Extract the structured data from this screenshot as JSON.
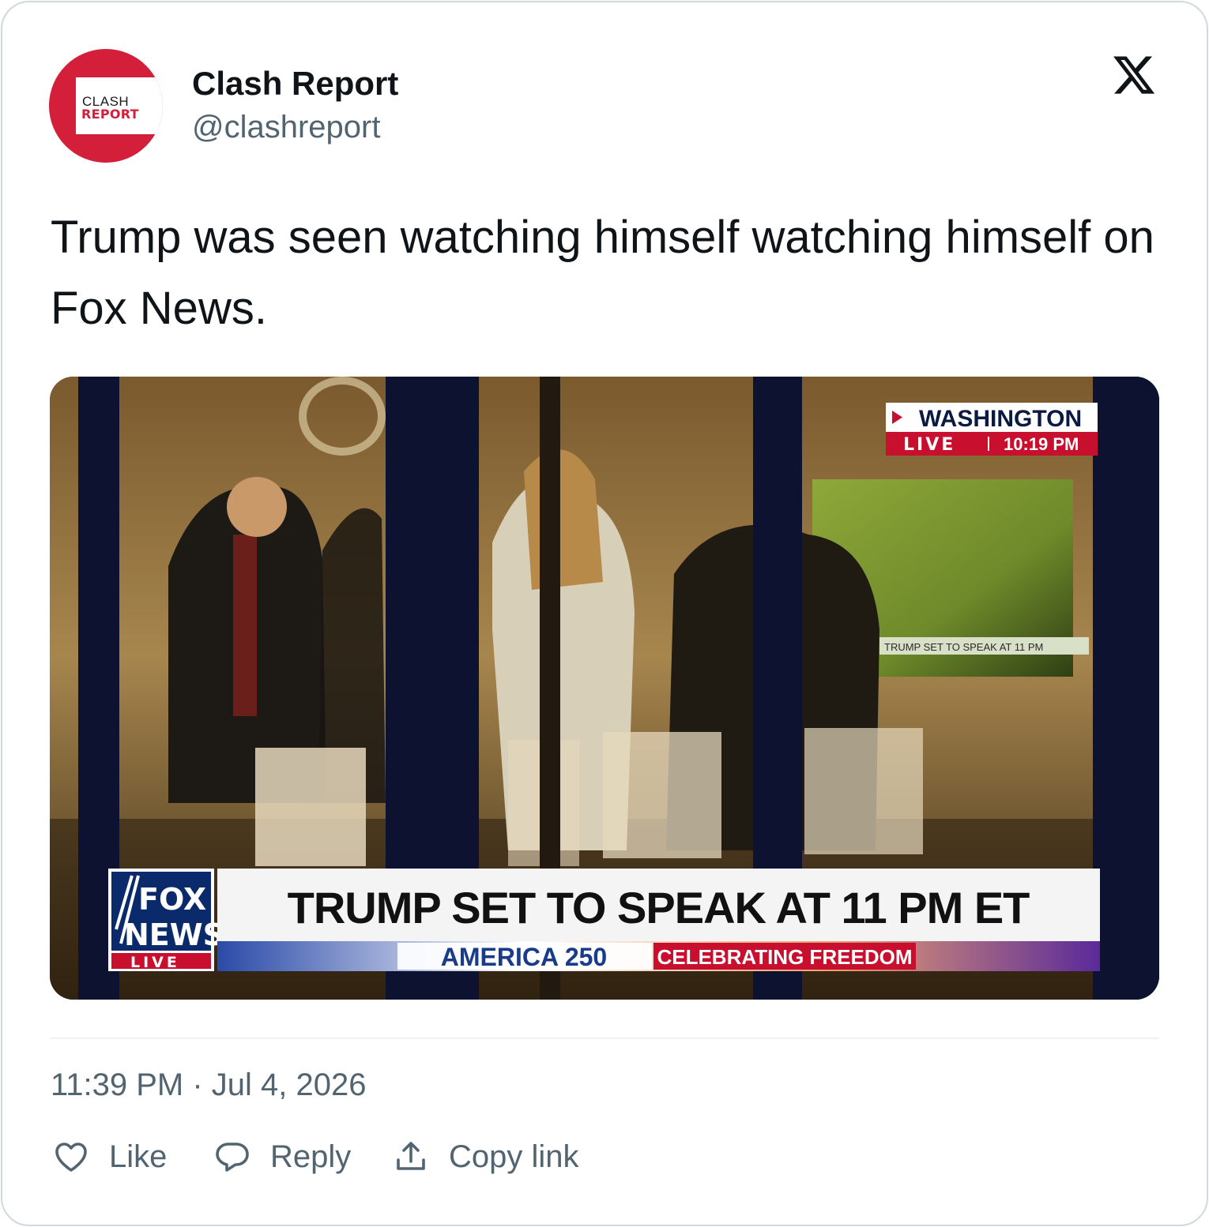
{
  "author": {
    "name": "Clash Report",
    "handle": "@clashreport",
    "avatar_text_top": "CLASH",
    "avatar_text_bottom": "REPORT",
    "avatar_color": "#d41f3a"
  },
  "platform_icon": "x-logo-icon",
  "tweet": {
    "text": "Trump was seen watching himself watching himself on Fox News."
  },
  "media": {
    "location_label": "WASHINGTON",
    "live_label": "LIVE",
    "time_label": "10:19 PM",
    "headline": "TRUMP SET TO SPEAK AT 11 PM ET",
    "network_top": "FOX",
    "network_bottom": "NEWS",
    "network_live": "LIVE",
    "program": "AMERICA 250",
    "tagline": "CELEBRATING FREEDOM",
    "inner_headline": "TRUMP SET TO SPEAK AT 11 PM",
    "accent_red": "#c8102e",
    "accent_navy": "#0a2a6b"
  },
  "meta": {
    "timestamp": "11:39 PM · Jul 4, 2026"
  },
  "actions": {
    "like": "Like",
    "reply": "Reply",
    "copy_link": "Copy link"
  }
}
